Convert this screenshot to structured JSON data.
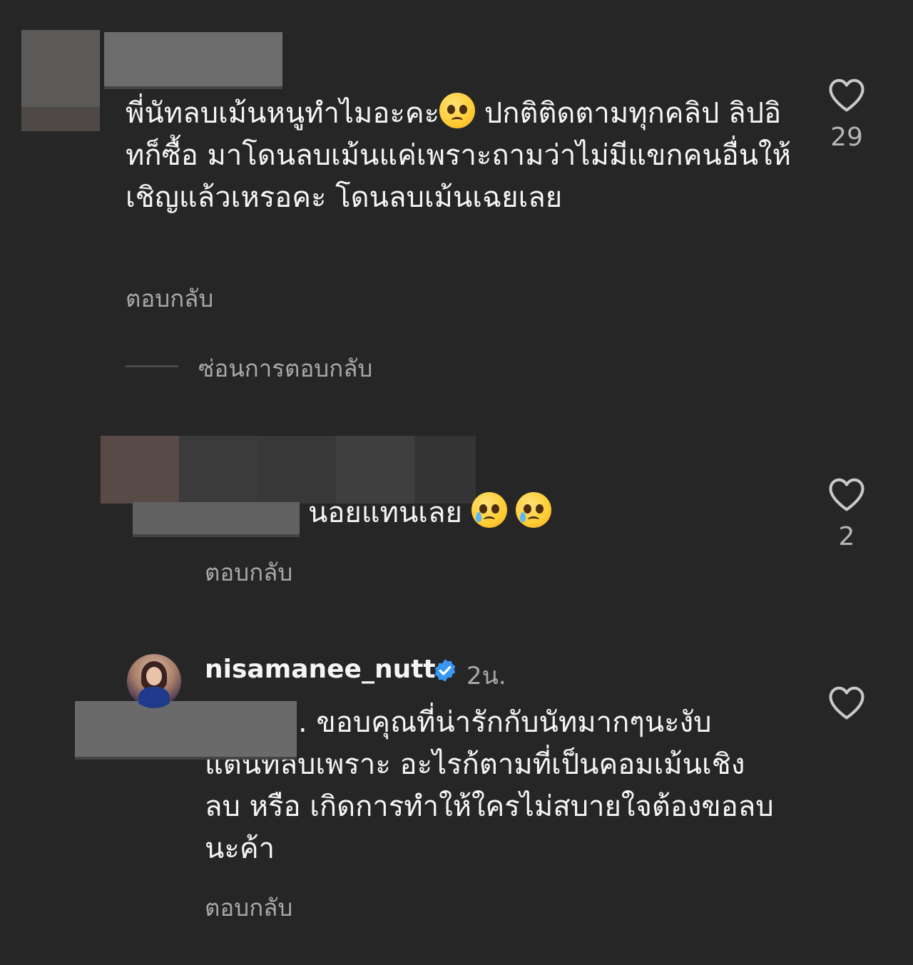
{
  "comments": [
    {
      "text_before_emoji": "พี่นัทลบเม้นหนูทำไมอะคะ",
      "emoji": "pleading-face-emoji",
      "text_after_emoji": " ปกติติดตามทุกคลิป ลิปอิทก็ซื้อ มาโดนลบเม้นแค่เพราะถามว่าไม่มีแขกคนอื่นให้เชิญแล้วเหรอคะ โดนลบเม้นเฉยเลย",
      "reply_label": "ตอบกลับ",
      "like_count": "29"
    },
    {
      "text": "นอยแทนเลย",
      "emoji": "face-holding-back-tears-emoji",
      "reply_label": "ตอบกลับ",
      "like_count": "2"
    },
    {
      "username": "nisamanee_nutt",
      "time": "2น.",
      "text_line_1": ". ขอบคุณที่น่ารักกับนัทมากๆนะงับ",
      "text_rest": "แต่นัทลบเพราะ อะไรก้ตามที่เป็นคอมเม้นเชิง ลบ หรือ เกิดการทำให้ใครไม่สบายใจต้องขอลบนะค้า",
      "reply_label": "ตอบกลับ"
    }
  ],
  "hide_replies_label": "ซ่อนการตอบกลับ",
  "colors": {
    "background": "#262626",
    "text": "#f5f5f5",
    "muted": "#a8a8a8",
    "verified": "#3897f0"
  },
  "icons": {
    "like": "heart-outline-icon",
    "verified": "verified-badge-icon"
  }
}
